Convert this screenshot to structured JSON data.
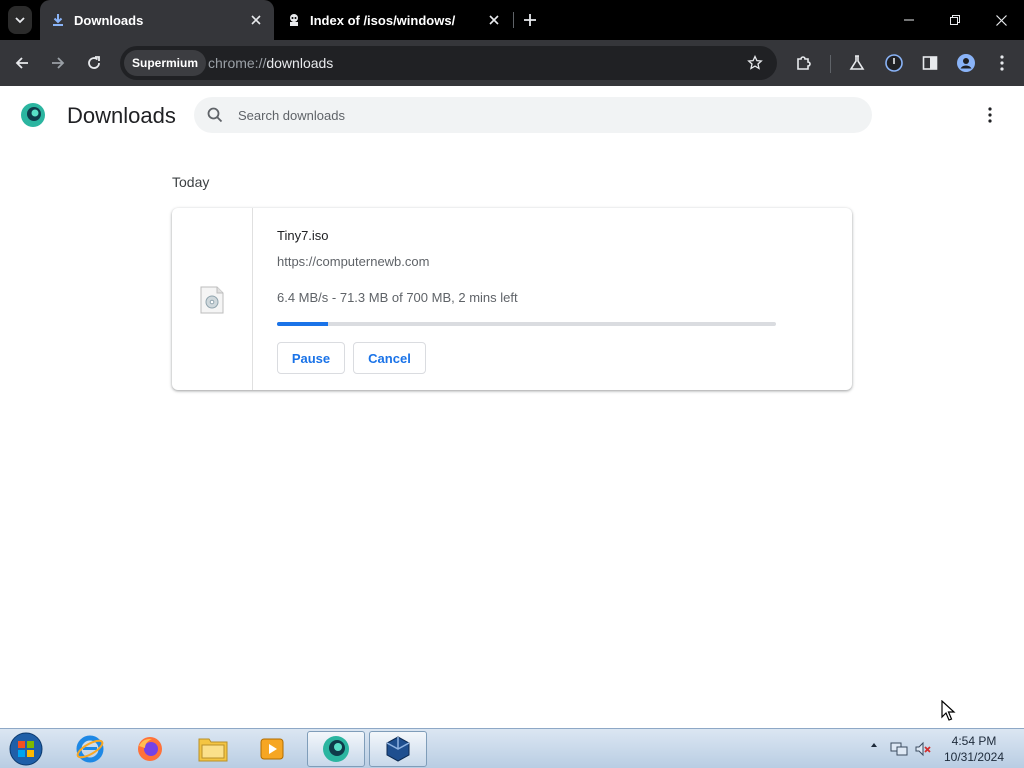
{
  "browser": {
    "tabs": [
      {
        "title": "Downloads",
        "icon": "download-icon",
        "active": true
      },
      {
        "title": "Index of /isos/windows/",
        "icon": "site-icon",
        "active": false
      }
    ],
    "omnibox": {
      "chip": "Supermium",
      "url_scheme": "chrome://",
      "url_host": "downloads"
    }
  },
  "page": {
    "title": "Downloads",
    "search_placeholder": "Search downloads",
    "section": "Today",
    "download": {
      "file_name": "Tiny7.iso",
      "source_url": "https://computernewb.com",
      "status": "6.4 MB/s - 71.3 MB of 700 MB, 2 mins left",
      "progress_fraction": 0.102,
      "pause_label": "Pause",
      "cancel_label": "Cancel"
    }
  },
  "taskbar": {
    "apps": [
      "internet-explorer-icon",
      "firefox-icon",
      "file-explorer-icon",
      "media-player-icon",
      "supermium-icon",
      "virtualbox-icon"
    ],
    "clock_time": "4:54 PM",
    "clock_date": "10/31/2024"
  },
  "colors": {
    "accent": "#1a73e8",
    "tabstrip": "#000000",
    "toolbar": "#35363a"
  }
}
